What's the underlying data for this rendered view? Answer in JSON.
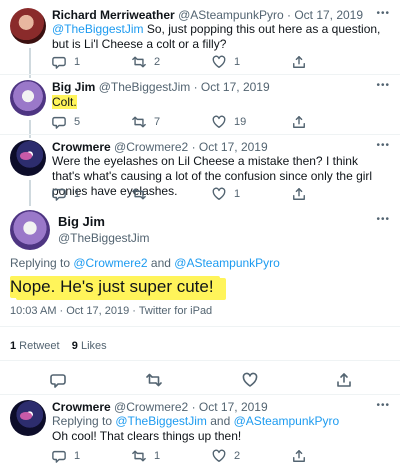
{
  "tweets": [
    {
      "name": "Richard Merriweather",
      "handle": "@ASteampunkPyro",
      "date": "Oct 17, 2019",
      "mention": "@TheBiggestJim",
      "text": " So, just popping this out here as a question, but is Li'l Cheese a colt or a filly?",
      "replies": "1",
      "retweets": "2",
      "likes": "1"
    },
    {
      "name": "Big Jim",
      "handle": "@TheBiggestJim",
      "date": "Oct 17, 2019",
      "text": "Colt.",
      "replies": "5",
      "retweets": "7",
      "likes": "19"
    },
    {
      "name": "Crowmere",
      "handle": "@Crowmere2",
      "date": "Oct 17, 2019",
      "text": "Were the eyelashes on Lil Cheese a mistake then? I think that's what's causing a lot of the confusion since only the girl ponies have eyelashes.",
      "replies": "1",
      "retweets": "",
      "likes": "1"
    }
  ],
  "main": {
    "name": "Big Jim",
    "handle": "@TheBiggestJim",
    "replying_label": "Replying to ",
    "reply_mention_1": "@Crowmere2",
    "reply_and": " and ",
    "reply_mention_2": "@ASteampunkPyro",
    "text": "Nope. He's just super cute!",
    "timestamp": "10:03 AM · Oct 17, 2019 · Twitter for iPad",
    "retweet_count": "1",
    "retweet_label": " Retweet",
    "like_count": "9",
    "like_label": " Likes"
  },
  "last_reply": {
    "name": "Crowmere",
    "handle": "@Crowmere2",
    "date": "Oct 17, 2019",
    "replying_label": "Replying to ",
    "reply_mention_1": "@TheBiggestJim",
    "reply_and": " and ",
    "reply_mention_2": "@ASteampunkPyro",
    "text": "Oh cool! That clears things up then!",
    "replies": "1",
    "retweets": "1",
    "likes": "2"
  },
  "separator": "·",
  "more_glyph": "•••",
  "colors": {
    "accent": "#1d9bf0",
    "highlight": "#fff45a",
    "muted": "#536471"
  }
}
